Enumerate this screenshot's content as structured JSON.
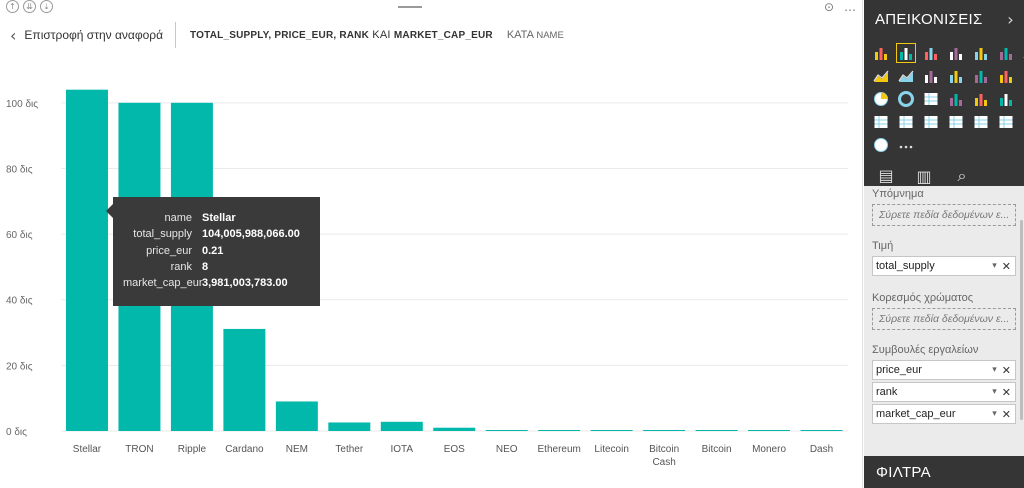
{
  "header": {
    "back_label": "Επιστροφή στην αναφορά",
    "fields_text": "TOTAL_SUPPLY, PRICE_EUR, RANK",
    "kai": " ΚΑΙ ",
    "fields_last": "MARKET_CAP_EUR",
    "by_word": "ΚΑΤΑ ",
    "by_field": "NAME"
  },
  "tooltip": {
    "rows": [
      {
        "key": "name",
        "value": "Stellar"
      },
      {
        "key": "total_supply",
        "value": "104,005,988,066.00"
      },
      {
        "key": "price_eur",
        "value": "0.21"
      },
      {
        "key": "rank",
        "value": "8"
      },
      {
        "key": "market_cap_eur",
        "value": "3,981,003,783.00"
      }
    ]
  },
  "chart_data": {
    "type": "bar",
    "categories": [
      "Stellar",
      "TRON",
      "Ripple",
      "Cardano",
      "NEM",
      "Tether",
      "IOTA",
      "EOS",
      "NEO",
      "Ethereum",
      "Litecoin",
      "Bitcoin Cash",
      "Bitcoin",
      "Monero",
      "Dash"
    ],
    "values": [
      104.0,
      100.0,
      100.0,
      31.1,
      9.0,
      2.6,
      2.8,
      1.0,
      0.07,
      0.1,
      0.06,
      0.02,
      0.02,
      0.02,
      0.01
    ],
    "yticks": [
      "0 δις",
      "20 δις",
      "40 δις",
      "60 δις",
      "80 δις",
      "100 δις"
    ],
    "ylim": [
      0,
      110
    ],
    "unit": "δις",
    "bar_color": "#01b8aa",
    "grid": true
  },
  "panel": {
    "title": "ΑΠΕΙΚΟΝΙΣΕΙΣ",
    "legend_label": "Υπόμνημα",
    "legend_placeholder": "Σύρετε πεδία δεδομένων ε...",
    "value_label": "Τιμή",
    "value_field": "total_supply",
    "color_sat_label": "Κορεσμός χρώματος",
    "color_sat_placeholder": "Σύρετε πεδία δεδομένων ε...",
    "tooltips_label": "Συμβουλές εργαλείων",
    "tooltip_fields": [
      "price_eur",
      "rank",
      "market_cap_eur"
    ],
    "filters_label": "ΦΙΛΤΡΑ",
    "accent": "#f2c811"
  }
}
